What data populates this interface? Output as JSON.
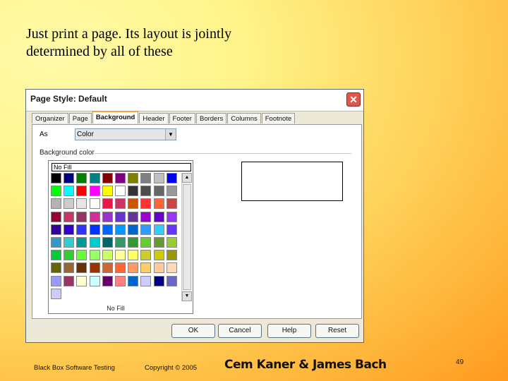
{
  "slide": {
    "title_line1": "Just print a page. Its layout is jointly",
    "title_line2": "determined by all of these"
  },
  "dialog": {
    "title": "Page Style: Default",
    "close_glyph": "✕",
    "close_icon": "close-icon",
    "tabs": [
      {
        "label": "Organizer",
        "active": false
      },
      {
        "label": "Page",
        "active": false
      },
      {
        "label": "Background",
        "active": true
      },
      {
        "label": "Header",
        "active": false
      },
      {
        "label": "Footer",
        "active": false
      },
      {
        "label": "Borders",
        "active": false
      },
      {
        "label": "Columns",
        "active": false
      },
      {
        "label": "Footnote",
        "active": false
      }
    ],
    "as_label": "As",
    "as_value": "Color",
    "background_color_label": "Background color",
    "no_fill_field": "No Fill",
    "no_fill_caption": "No Fill",
    "buttons": {
      "ok": "OK",
      "cancel": "Cancel",
      "help": "Help",
      "reset": "Reset"
    },
    "palette": [
      [
        "#000000",
        "#000080",
        "#008000",
        "#008080",
        "#800000",
        "#800080",
        "#808000",
        "#808080",
        "#c0c0c0",
        "#0000ff"
      ],
      [
        "#00ff00",
        "#00ffff",
        "#ff0000",
        "#ff00ff",
        "#ffff00",
        "#ffffff",
        "#333333",
        "#4d4d4d",
        "#666666",
        "#999999"
      ],
      [
        "#b3b3b3",
        "#cccccc",
        "#e6e6e6",
        "#ffffff",
        "#e6194b",
        "#cc3366",
        "#cc5500",
        "#ff3333",
        "#ff6633",
        "#cc4444"
      ],
      [
        "#990033",
        "#cc3366",
        "#993366",
        "#cc3399",
        "#9933cc",
        "#6633cc",
        "#663399",
        "#9900cc",
        "#6600cc",
        "#9933ff"
      ],
      [
        "#330099",
        "#3300cc",
        "#3333ff",
        "#0033ff",
        "#0066ff",
        "#0099ff",
        "#0066cc",
        "#3399ff",
        "#33ccff",
        "#6633ff"
      ],
      [
        "#3399cc",
        "#33cccc",
        "#009999",
        "#00cccc",
        "#006666",
        "#339966",
        "#339933",
        "#66cc33",
        "#669933",
        "#99cc33"
      ],
      [
        "#00cc33",
        "#33cc33",
        "#66ff33",
        "#99ff66",
        "#ccff66",
        "#ffff99",
        "#ffff66",
        "#cccc33",
        "#cccc00",
        "#999900"
      ],
      [
        "#666600",
        "#996633",
        "#663300",
        "#993300",
        "#cc6633",
        "#ff6633",
        "#ff9966",
        "#ffcc66",
        "#ffcc99",
        "#ffd9b3"
      ],
      [
        "#9999ff",
        "#993366",
        "#ffffcc",
        "#ccffff",
        "#660066",
        "#ff8080",
        "#0066cc",
        "#ccccff",
        "#000080",
        "#6666cc"
      ],
      [
        "#ccccff"
      ]
    ]
  },
  "footer": {
    "left": "Black Box Software Testing",
    "copyright": "Copyright ©  2005",
    "authors": "Cem Kaner & James Bach",
    "page": "49"
  }
}
